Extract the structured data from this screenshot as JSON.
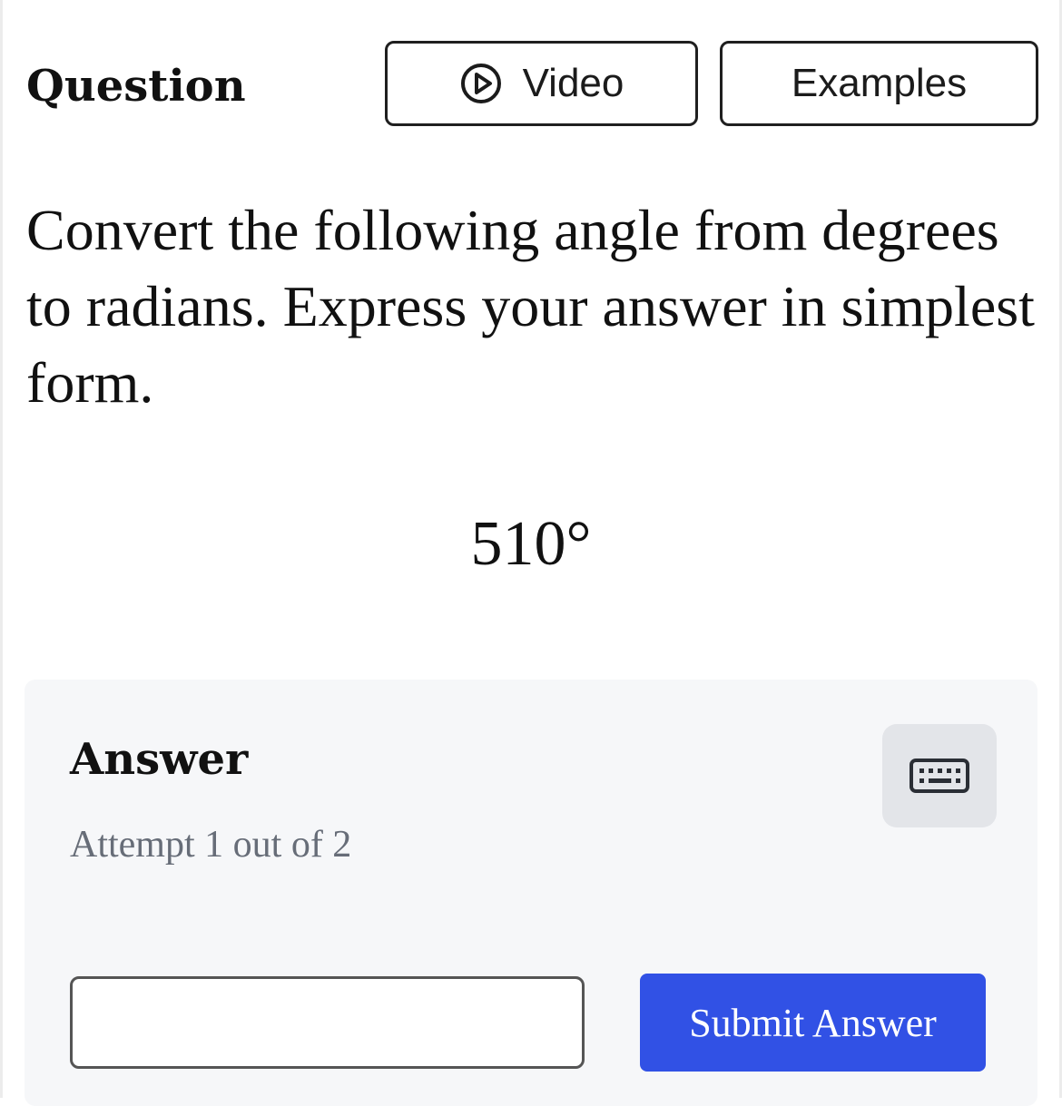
{
  "header": {
    "title": "Question",
    "video_label": "Video",
    "examples_label": "Examples",
    "video_icon": "play-circle-icon"
  },
  "question": {
    "prompt": "Convert the following angle from degrees to radians. Express your answer in simplest form.",
    "expression": "510°"
  },
  "answer": {
    "heading": "Answer",
    "attempt_text": "Attempt 1 out of 2",
    "keyboard_icon": "keyboard-icon",
    "input_value": "",
    "input_placeholder": "",
    "submit_label": "Submit Answer"
  },
  "colors": {
    "accent": "#3151e5",
    "panel_background": "#f6f7f9",
    "keyboard_button_background": "#e3e5e9",
    "muted_text": "#676d78"
  }
}
